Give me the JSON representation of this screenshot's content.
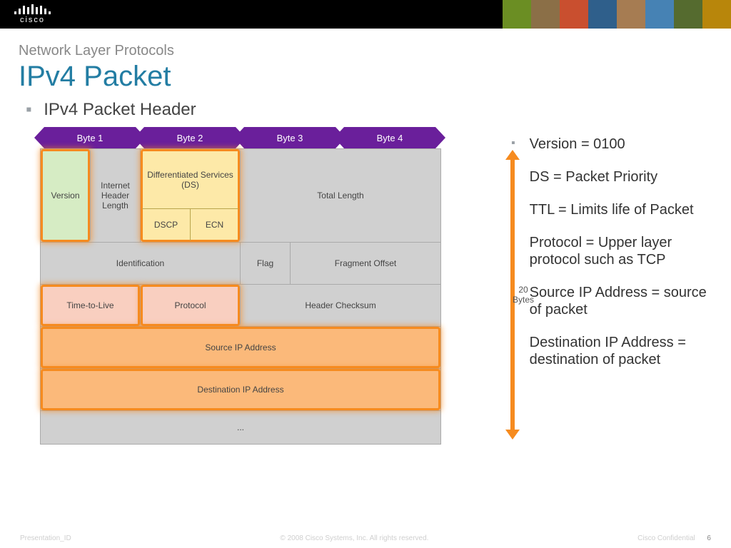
{
  "brand": "cisco",
  "subtitle": "Network Layer Protocols",
  "title": "IPv4 Packet",
  "section_heading": "IPv4 Packet Header",
  "byte_arrows": [
    "Byte 1",
    "Byte 2",
    "Byte 3",
    "Byte 4"
  ],
  "packet": {
    "row0": {
      "version": "Version",
      "ihl": "Internet Header Length",
      "ds_label": "Differentiated Services (DS)",
      "dscp": "DSCP",
      "ecn": "ECN",
      "total_length": "Total Length"
    },
    "row1": {
      "identification": "Identification",
      "flag": "Flag",
      "fragment_offset": "Fragment Offset"
    },
    "row2": {
      "ttl": "Time-to-Live",
      "protocol": "Protocol",
      "checksum": "Header Checksum"
    },
    "row3": {
      "src": "Source IP Address"
    },
    "row4": {
      "dst": "Destination IP Address"
    },
    "row5": {
      "ellipsis": "..."
    }
  },
  "size_label": {
    "value": "20",
    "unit": "Bytes"
  },
  "bullets": [
    "Version = 0100",
    "DS = Packet Priority",
    "TTL = Limits life of Packet",
    "Protocol = Upper layer protocol such as TCP",
    "Source IP Address = source of packet",
    "Destination IP Address = destination of packet"
  ],
  "footer": {
    "left": "Presentation_ID",
    "center": "© 2008 Cisco Systems, Inc. All rights reserved.",
    "right_label": "Cisco Confidential",
    "page": "6"
  },
  "chart_data": {
    "type": "table",
    "title": "IPv4 Packet Header layout (20 bytes, 4-byte rows)",
    "columns": [
      "Byte 1",
      "Byte 2",
      "Byte 3",
      "Byte 4"
    ],
    "rows": [
      [
        "Version / Internet Header Length",
        "Differentiated Services (DSCP + ECN)",
        "Total Length",
        "Total Length"
      ],
      [
        "Identification",
        "Identification",
        "Flag",
        "Fragment Offset"
      ],
      [
        "Time-to-Live",
        "Protocol",
        "Header Checksum",
        "Header Checksum"
      ],
      [
        "Source IP Address",
        "Source IP Address",
        "Source IP Address",
        "Source IP Address"
      ],
      [
        "Destination IP Address",
        "Destination IP Address",
        "Destination IP Address",
        "Destination IP Address"
      ]
    ],
    "highlighted_fields": [
      "Version",
      "Differentiated Services (DS)",
      "Time-to-Live",
      "Protocol",
      "Source IP Address",
      "Destination IP Address"
    ],
    "total_header_bytes": 20
  }
}
